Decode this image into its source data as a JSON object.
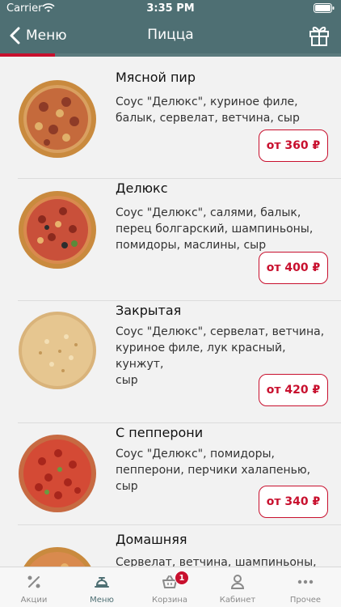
{
  "status_bar": {
    "carrier": "Carrier",
    "time": "3:35 PM"
  },
  "nav": {
    "back_label": "Меню",
    "title": "Пицца",
    "gift_icon": "gift-icon"
  },
  "progress": {
    "fraction": 0.16,
    "color": "#c8102e"
  },
  "colors": {
    "header_bg": "#4e6f73",
    "accent": "#c8102e"
  },
  "items": [
    {
      "name": "Мясной пир",
      "description": [
        "Соус \"Делюкс\", куриное филе,",
        "балык, сервелат, ветчина, сыр"
      ],
      "price": "от 360 ₽"
    },
    {
      "name": "Делюкс",
      "description": [
        "Соус \"Делюкс\", салями, балык,",
        "перец болгарский, шампиньоны,",
        "помидоры, маслины, сыр"
      ],
      "price": "от 400 ₽"
    },
    {
      "name": "Закрытая",
      "description": [
        "Соус \"Делюкс\", сервелат, ветчина,",
        "куриное филе, лук красный, кунжут,",
        "сыр"
      ],
      "price": "от 420 ₽"
    },
    {
      "name": "С пепперони",
      "description": [
        "Соус \"Делюкс\", помидоры,",
        "пепперони, перчики халапенью, сыр"
      ],
      "price": "от 340 ₽"
    },
    {
      "name": "Домашняя",
      "description": [
        "Сервелат, ветчина, шампиньоны,"
      ],
      "price": ""
    }
  ],
  "tabs": [
    {
      "label": "Акции",
      "icon": "percent-icon"
    },
    {
      "label": "Меню",
      "icon": "food-menu-icon"
    },
    {
      "label": "Корзина",
      "icon": "basket-icon",
      "badge": "1"
    },
    {
      "label": "Кабинет",
      "icon": "user-icon"
    },
    {
      "label": "Прочее",
      "icon": "more-icon"
    }
  ]
}
